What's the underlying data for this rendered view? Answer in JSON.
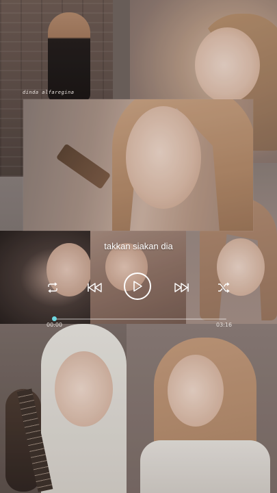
{
  "watermark": {
    "text": "dinda alfaregina"
  },
  "player": {
    "lyric": "takkan siakan dia",
    "controls": {
      "repeat_icon": "repeat-icon",
      "previous_icon": "skip-previous-icon",
      "play_icon": "play-icon",
      "next_icon": "skip-next-icon",
      "shuffle_icon": "shuffle-icon"
    },
    "progress": {
      "elapsed": "00:00",
      "total": "03:16",
      "fraction": 0.01
    },
    "accent_color": "#6fd6e0"
  }
}
